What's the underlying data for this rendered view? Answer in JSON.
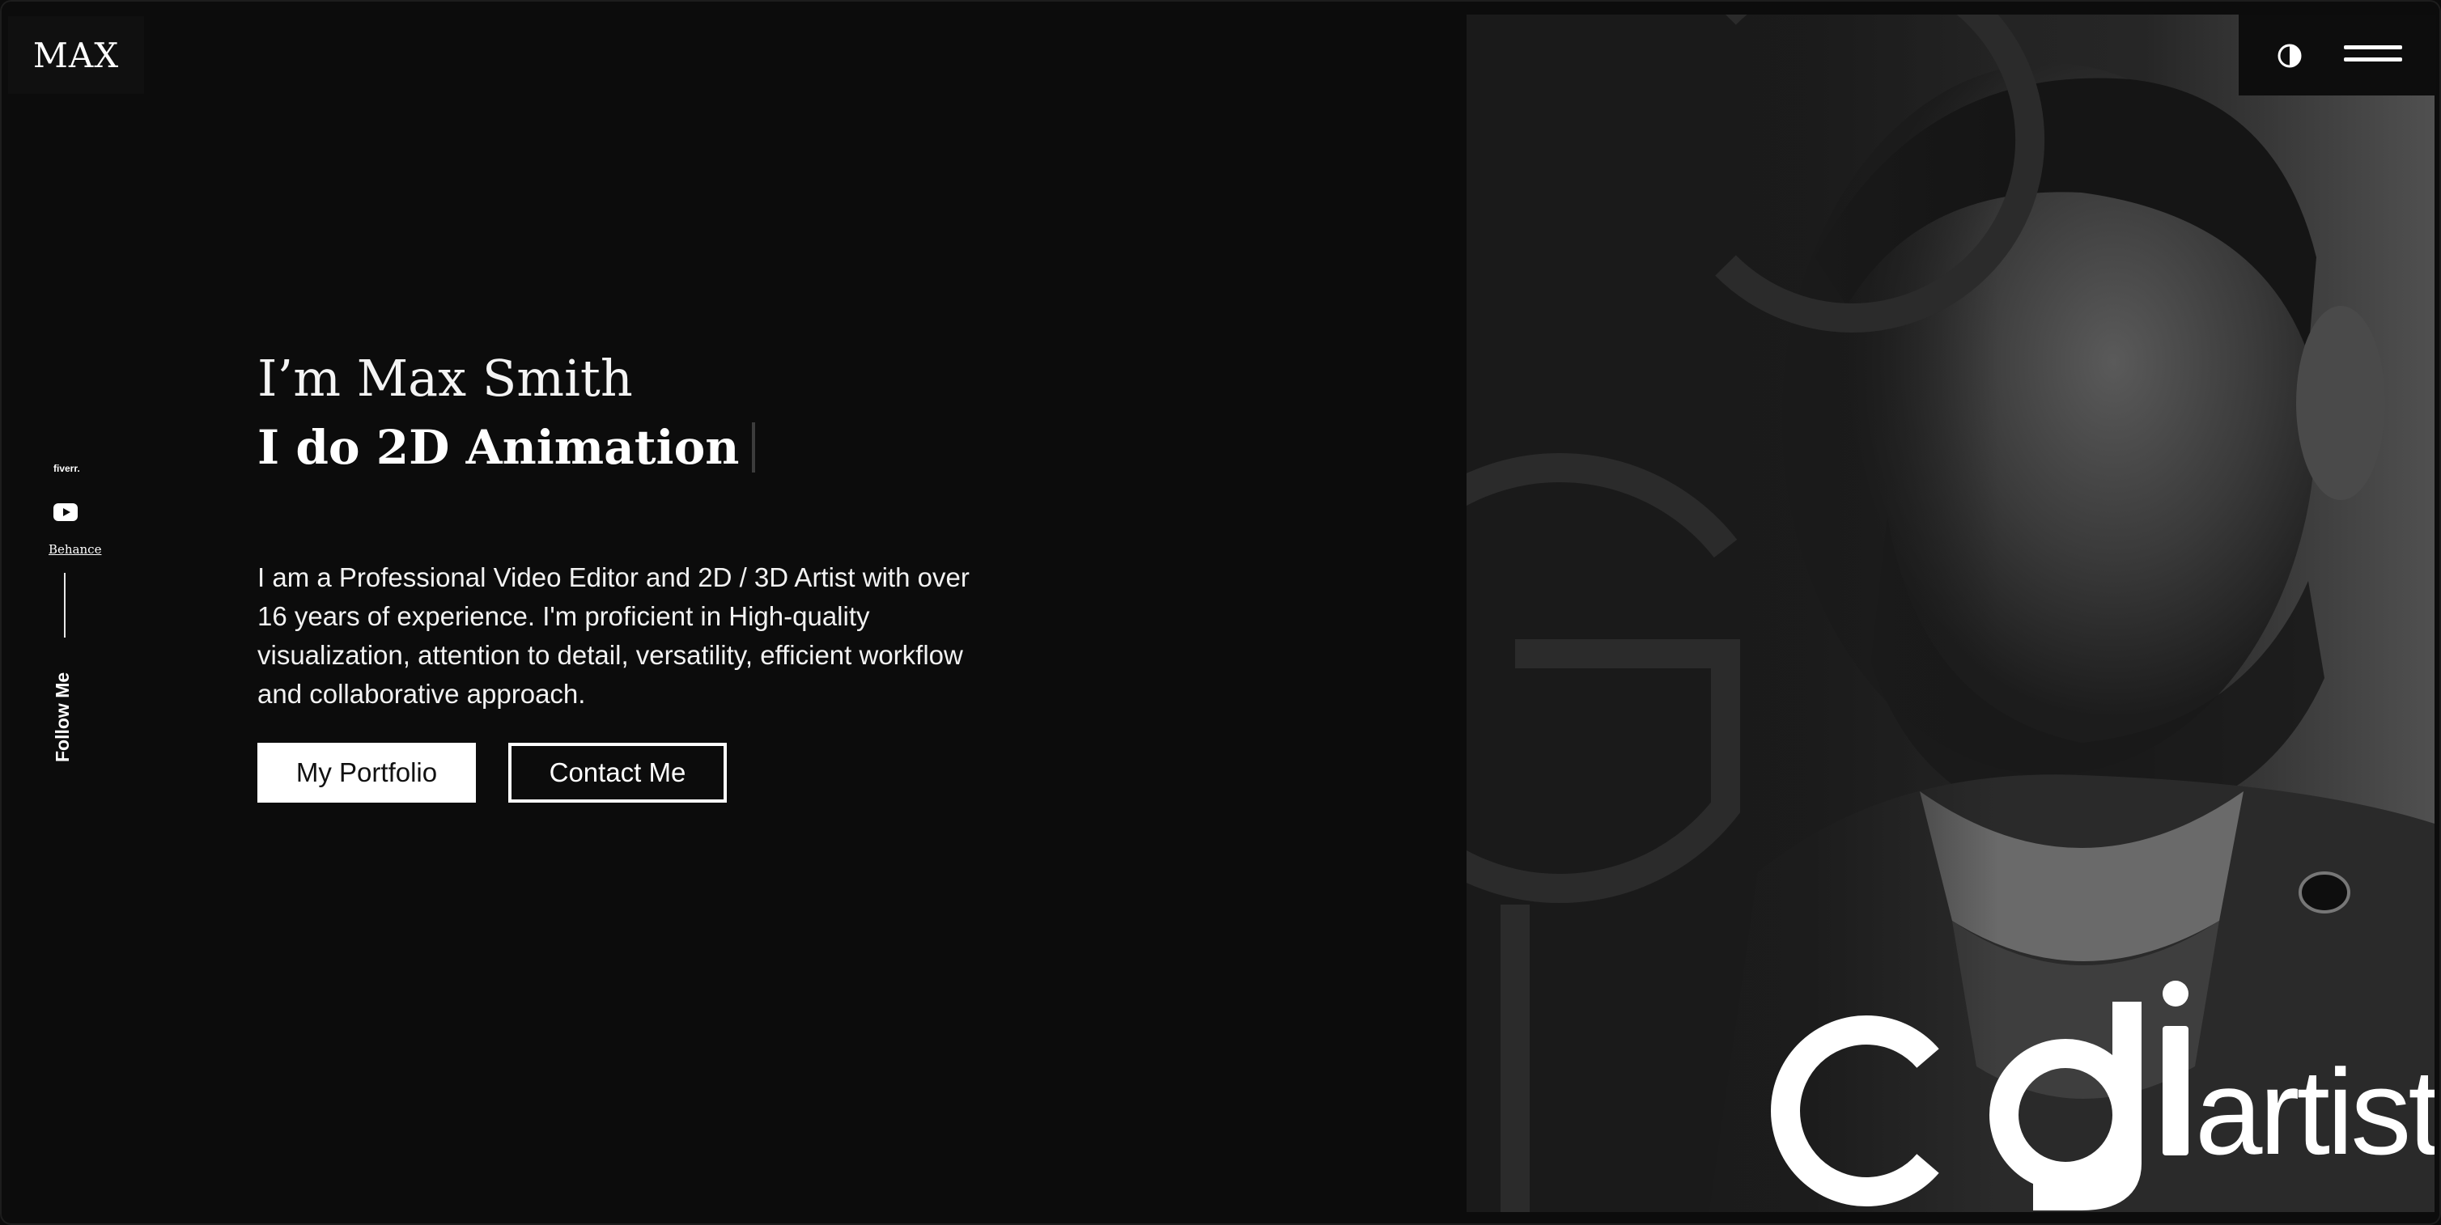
{
  "brand": {
    "logo_text": "MAX"
  },
  "social": {
    "fiverr_label": "fiverr.",
    "youtube_icon": "youtube-icon",
    "behance_label": "Behance",
    "follow_label": "Follow Me"
  },
  "hero": {
    "greeting": "I’m Max Smith",
    "role": "I do 2D Animation",
    "bio": "I am a Professional Video Editor and 2D / 3D Artist with over 16 years of experience. I'm proficient in High-quality visualization, attention to detail, versatility, efficient workflow and collaborative approach.",
    "primary_button": "My Portfolio",
    "secondary_button": "Contact Me"
  },
  "image": {
    "overlay_logo_text": "cgiartist",
    "background_letters": "CGI"
  },
  "toolbar": {
    "theme_icon": "contrast-icon",
    "menu_icon": "hamburger-menu-icon"
  },
  "colors": {
    "background": "#0c0c0c",
    "panel": "#1a1a1a",
    "text": "#ffffff",
    "button_bg": "#ffffff",
    "button_text": "#111111"
  }
}
